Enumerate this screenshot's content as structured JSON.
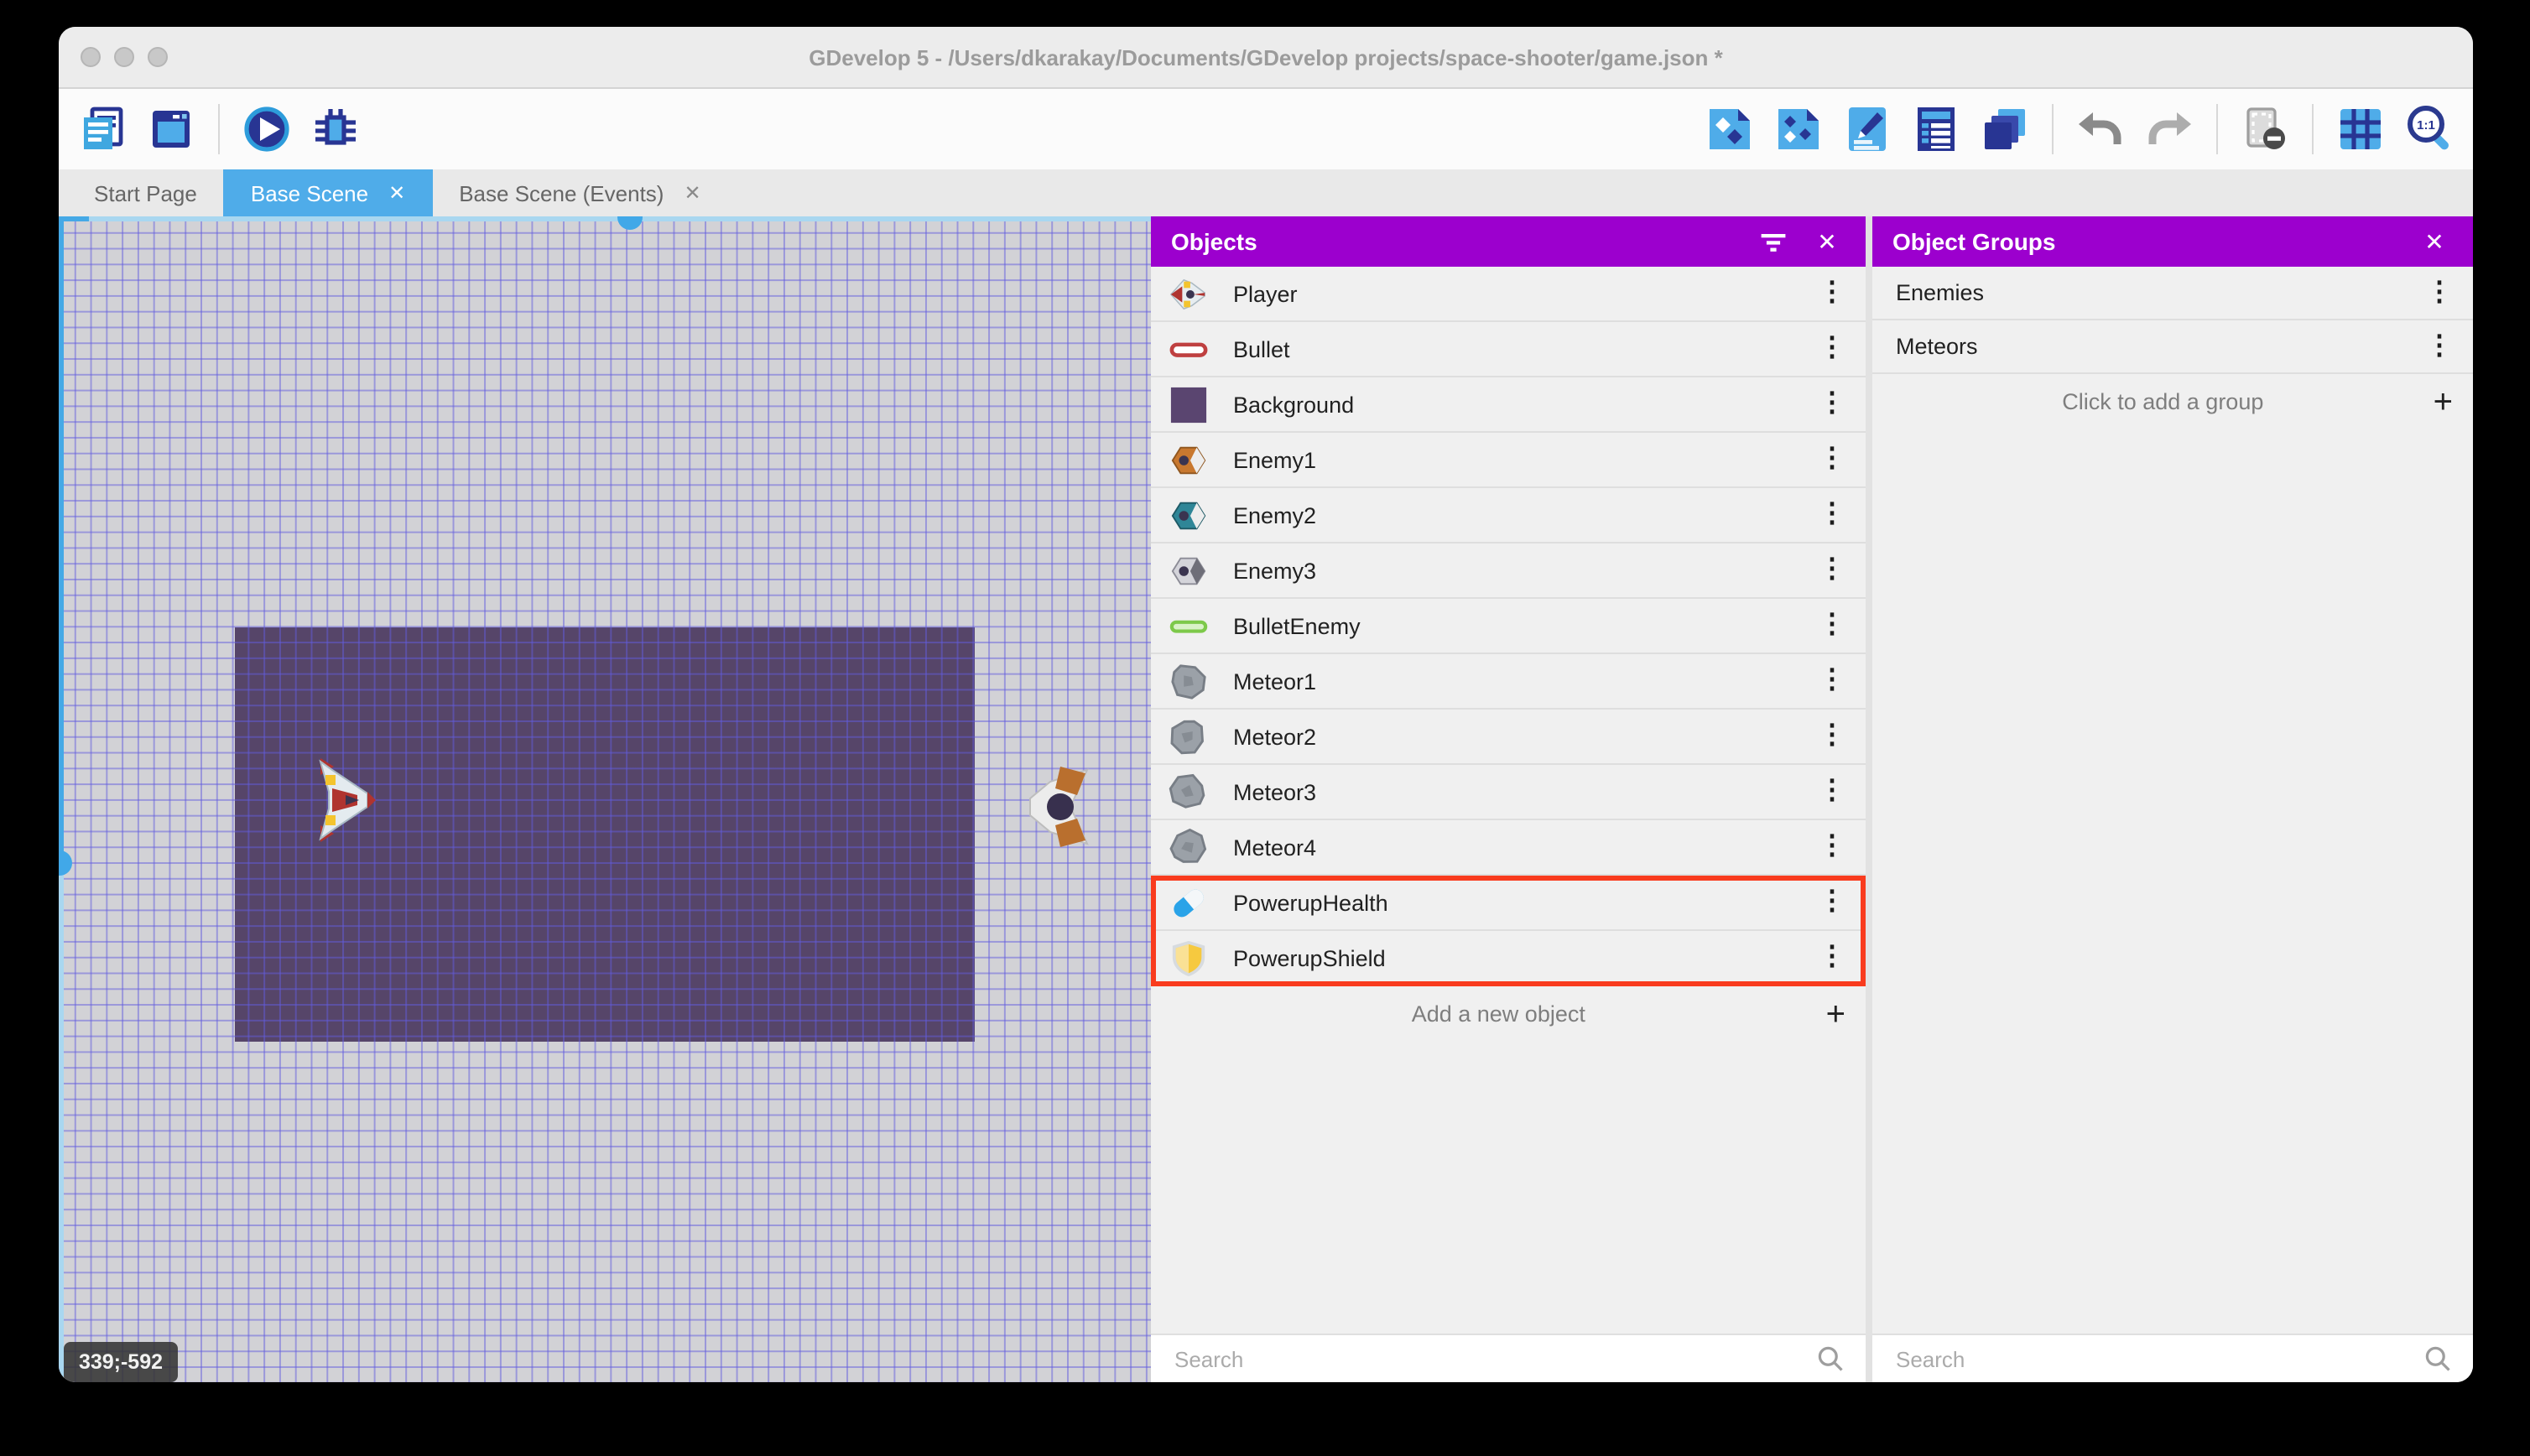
{
  "window": {
    "title": "GDevelop 5 - /Users/dkarakay/Documents/GDevelop projects/space-shooter/game.json *"
  },
  "toolbar": {
    "left_icons": [
      "project-manager-icon",
      "preview-window-icon",
      "play-icon",
      "debug-icon"
    ],
    "right_icons": [
      "objects-editor-icon",
      "object-groups-editor-icon",
      "properties-icon",
      "instances-list-icon",
      "layers-icon",
      "undo-icon",
      "redo-icon",
      "render-options-icon",
      "grid-icon",
      "zoom-1-1-icon"
    ]
  },
  "tabs": [
    {
      "label": "Start Page",
      "active": false,
      "closable": false
    },
    {
      "label": "Base Scene",
      "active": true,
      "closable": true
    },
    {
      "label": "Base Scene (Events)",
      "active": false,
      "closable": true
    }
  ],
  "canvas": {
    "coordinate_badge": "339;-592",
    "scene_background_color": "#564569",
    "grid_line_color": "#625CDE",
    "sprites": [
      "player-ship",
      "enemy-ship"
    ]
  },
  "objects_panel": {
    "title": "Objects",
    "rows": [
      {
        "label": "Player",
        "icon": "player-ship-icon"
      },
      {
        "label": "Bullet",
        "icon": "bullet-icon"
      },
      {
        "label": "Background",
        "icon": "background-swatch-icon"
      },
      {
        "label": "Enemy1",
        "icon": "enemy1-ship-icon"
      },
      {
        "label": "Enemy2",
        "icon": "enemy2-ship-icon"
      },
      {
        "label": "Enemy3",
        "icon": "enemy3-ship-icon"
      },
      {
        "label": "BulletEnemy",
        "icon": "enemy-bullet-icon"
      },
      {
        "label": "Meteor1",
        "icon": "meteor-icon"
      },
      {
        "label": "Meteor2",
        "icon": "meteor-icon"
      },
      {
        "label": "Meteor3",
        "icon": "meteor-icon"
      },
      {
        "label": "Meteor4",
        "icon": "meteor-icon"
      },
      {
        "label": "PowerupHealth",
        "icon": "health-pill-icon"
      },
      {
        "label": "PowerupShield",
        "icon": "shield-icon"
      }
    ],
    "highlight": {
      "rows": [
        "PowerupHealth",
        "PowerupShield"
      ],
      "color": "#F93B1E"
    },
    "add_row_label": "Add a new object",
    "search_placeholder": "Search"
  },
  "groups_panel": {
    "title": "Object Groups",
    "rows": [
      {
        "label": "Enemies"
      },
      {
        "label": "Meteors"
      }
    ],
    "add_row_label": "Click to add a group",
    "search_placeholder": "Search"
  },
  "glyphs": {
    "close": "✕",
    "plus": "+",
    "kebab": "⋮"
  },
  "colors": {
    "accent_blue": "#4FACE9",
    "panel_header_purple": "#9C00CE",
    "highlight_red": "#F93B1E",
    "canvas_bg": "#D2D2D6",
    "scene_purple": "#564569"
  }
}
